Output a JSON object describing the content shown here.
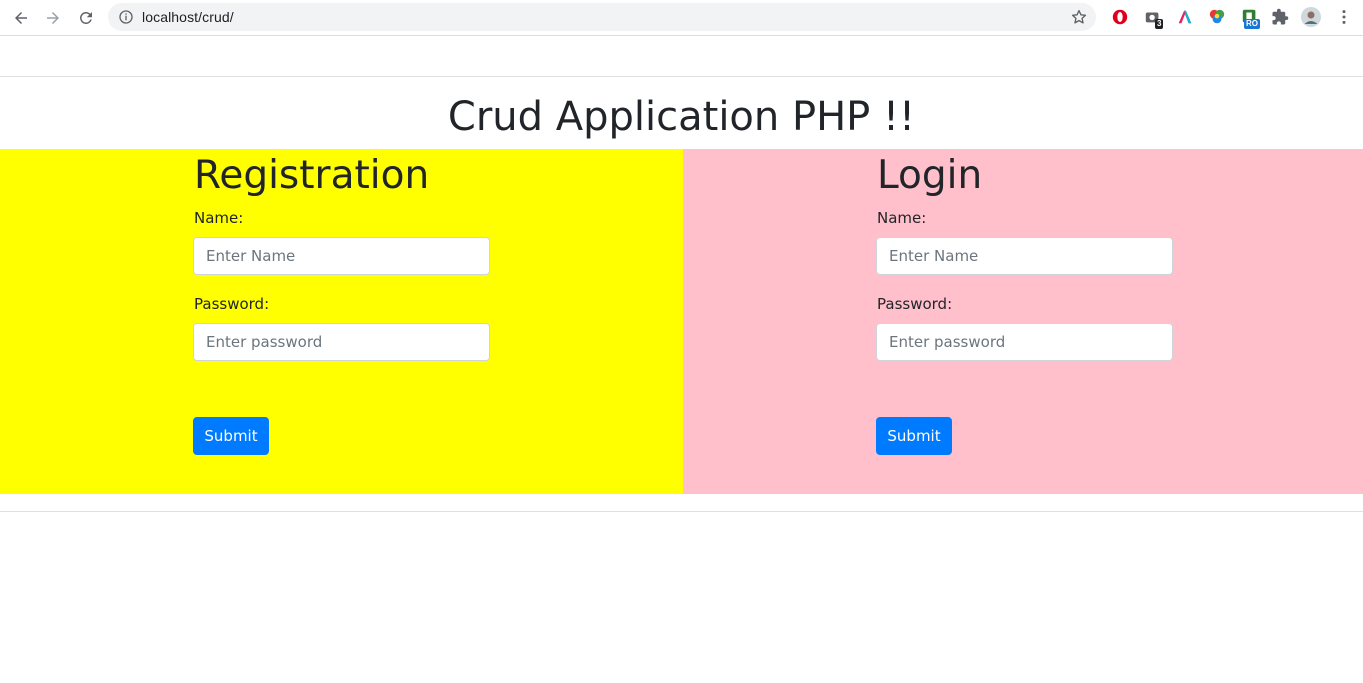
{
  "browser": {
    "url": "localhost/crud/",
    "extension_badges": {
      "second": "3",
      "fifth": "RO"
    }
  },
  "page": {
    "title": "Crud Application PHP !!"
  },
  "registration": {
    "heading": "Registration",
    "name_label": "Name:",
    "name_placeholder": "Enter Name",
    "password_label": "Password:",
    "password_placeholder": "Enter password",
    "submit_label": "Submit",
    "background": "#ffff00"
  },
  "login": {
    "heading": "Login",
    "name_label": "Name:",
    "name_placeholder": "Enter Name",
    "password_label": "Password:",
    "password_placeholder": "Enter password",
    "submit_label": "Submit",
    "background": "#ffc0cb"
  },
  "colors": {
    "button": "#007bff"
  }
}
